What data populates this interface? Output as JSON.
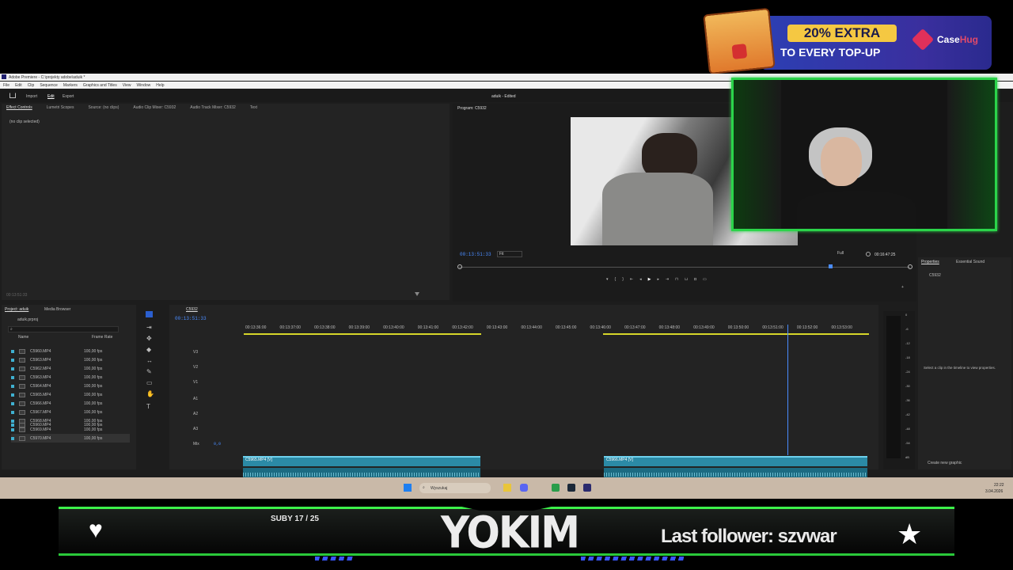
{
  "ad": {
    "extra": "20% EXTRA",
    "line2": "TO EVERY TOP-UP",
    "brand_a": "Case",
    "brand_b": "Hug"
  },
  "premiere": {
    "title": "Adobe Premiere - C:\\projekty adobe\\aduik *",
    "menu": [
      "File",
      "Edit",
      "Clip",
      "Sequence",
      "Markers",
      "Graphics and Titles",
      "View",
      "Window",
      "Help"
    ],
    "workspace": {
      "import": "Import",
      "edit": "Edit",
      "export": "Export",
      "project": "aduik - Edited"
    },
    "source_tabs": [
      "Effect Controls",
      "Lumetri Scopes",
      "Source: (no clips)",
      "Audio Clip Mixer: C5932",
      "Audio Track Mixer: C5932",
      "Text"
    ],
    "no_clip": "(no clip selected)",
    "source_tc": "00:13:51:33",
    "program": {
      "tab": "Program: C5932",
      "tc": "00:13:51:33",
      "fit": "Fit",
      "full": "Full",
      "duration": "00:16:47:25"
    },
    "properties": {
      "tabs": [
        "Properties",
        "Essential Sound"
      ],
      "seq": "C5932",
      "hint": "Select a clip in the timeline to view properties.",
      "create": "Create new graphic"
    },
    "project": {
      "tabs": [
        "Project: aduik",
        "Media Browser"
      ],
      "file": "aduik.prproj",
      "col_name": "Name",
      "col_rate": "Frame Rate",
      "items": [
        {
          "name": "C5960.MP4",
          "rate": "100,00 fps"
        },
        {
          "name": "C5963.MP4",
          "rate": "100,00 fps"
        },
        {
          "name": "C5962.MP4",
          "rate": "100,00 fps"
        },
        {
          "name": "C5963.MP4",
          "rate": "100,00 fps"
        },
        {
          "name": "C5964.MP4",
          "rate": "100,00 fps"
        },
        {
          "name": "C5965.MP4",
          "rate": "100,00 fps"
        },
        {
          "name": "C5966.MP4",
          "rate": "100,00 fps"
        },
        {
          "name": "C5967.MP4",
          "rate": "100,00 fps"
        },
        {
          "name": "C5968.MP4",
          "rate": "100,00 fps"
        },
        {
          "name": "C5969.MP4",
          "rate": "100,00 fps"
        },
        {
          "name": "C5970.MP4",
          "rate": "100,00 fps"
        }
      ]
    },
    "timeline": {
      "tab": "C5932",
      "tc": "00:13:51:33",
      "ruler": [
        "00:13:36:00",
        "00:13:37:00",
        "00:13:38:00",
        "00:13:39:00",
        "00:13:40:00",
        "00:13:41:00",
        "00:13:42:00",
        "00:13:43:00",
        "00:13:44:00",
        "00:13:45:00",
        "00:13:46:00",
        "00:13:47:00",
        "00:13:48:00",
        "00:13:49:00",
        "00:13:50:00",
        "00:13:51:00",
        "00:13:52:00",
        "00:13:53:00"
      ],
      "tracks": [
        "V3",
        "V2",
        "V1",
        "A1",
        "A2",
        "A3",
        "Mix"
      ],
      "mix_val": "0,0",
      "clip1": "C5965.MP4 [V]",
      "clip2": "C5966.MP4 [V]"
    },
    "meter": [
      "0",
      "-6",
      "-12",
      "-18",
      "-24",
      "-30",
      "-36",
      "-42",
      "-48",
      "-54",
      "dB"
    ]
  },
  "taskbar": {
    "search": "Wyszukaj",
    "time": "22:22",
    "date": "3.04.2026"
  },
  "overlay": {
    "subs": "SUBY 17 / 25",
    "name": "YOKIM",
    "follower": "Last follower: szvwar"
  },
  "colors": {
    "green": "#2bd44a",
    "accent": "#4a8cff",
    "clip": "#2b8aa6"
  }
}
